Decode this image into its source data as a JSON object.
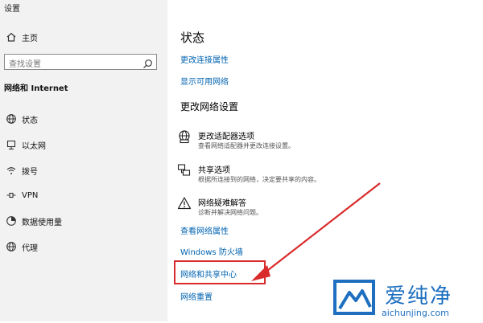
{
  "window": {
    "title": "设置"
  },
  "sidebar": {
    "home_label": "主页",
    "search_placeholder": "查找设置",
    "section_title": "网络和 Internet",
    "items": [
      {
        "label": "状态",
        "icon": "globe-icon"
      },
      {
        "label": "以太网",
        "icon": "ethernet-icon"
      },
      {
        "label": "拨号",
        "icon": "dialup-icon"
      },
      {
        "label": "VPN",
        "icon": "vpn-icon"
      },
      {
        "label": "数据使用量",
        "icon": "data-usage-icon"
      },
      {
        "label": "代理",
        "icon": "proxy-globe-icon"
      }
    ]
  },
  "main": {
    "title": "状态",
    "links_top": [
      "更改连接属性",
      "显示可用网络"
    ],
    "change_section_title": "更改网络设置",
    "options": [
      {
        "title": "更改适配器选项",
        "description": "查看网络适配器并更改连接设置。",
        "icon": "adapter-icon"
      },
      {
        "title": "共享选项",
        "description": "根据所连接到的网络，决定要共享的内容。",
        "icon": "sharing-icon"
      },
      {
        "title": "网络疑难解答",
        "description": "诊断并解决网络问题。",
        "icon": "warning-icon"
      }
    ],
    "links_bottom": [
      "查看网络属性",
      "Windows 防火墙",
      "网络和共享中心",
      "网络重置"
    ]
  },
  "annotation": {
    "highlight_color": "#d92b2b"
  },
  "watermark": {
    "title": "爱纯净",
    "url": "aichunjing.com",
    "color": "#1e6fc0"
  }
}
